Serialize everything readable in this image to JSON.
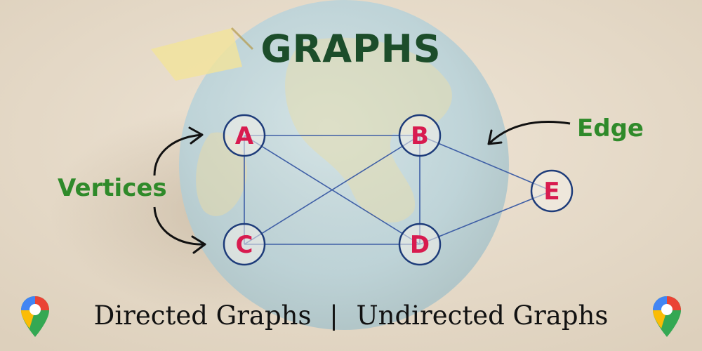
{
  "title": "GRAPHS",
  "labels": {
    "edge": "Edge",
    "vertices": "Vertices"
  },
  "nodes": [
    {
      "id": "A"
    },
    {
      "id": "B"
    },
    {
      "id": "C"
    },
    {
      "id": "D"
    },
    {
      "id": "E"
    }
  ],
  "edges": [
    [
      "A",
      "B"
    ],
    [
      "A",
      "C"
    ],
    [
      "A",
      "D"
    ],
    [
      "B",
      "C"
    ],
    [
      "B",
      "D"
    ],
    [
      "B",
      "E"
    ],
    [
      "C",
      "D"
    ],
    [
      "D",
      "E"
    ]
  ],
  "caption": {
    "left": "Directed Graphs",
    "separator": "|",
    "right": "Undirected Graphs"
  },
  "icons": {
    "pin": "map-pin-icon"
  },
  "colors": {
    "title": "#1c4d2a",
    "label_green": "#2f8a2a",
    "node_letter": "#d81b4f",
    "node_ring": "#1e3c7a",
    "edge_line": "#3f5fa6",
    "sand": "#e8dccb"
  }
}
